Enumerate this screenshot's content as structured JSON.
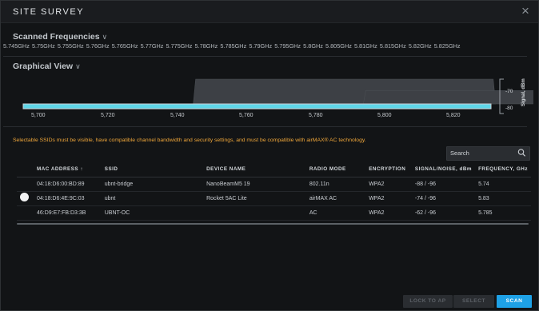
{
  "dialog": {
    "title": "SITE SURVEY",
    "close_glyph": "×"
  },
  "scanned": {
    "title": "Scanned Frequencies",
    "frequencies": [
      "5.745GHz",
      "5.75GHz",
      "5.755GHz",
      "5.76GHz",
      "5.765GHz",
      "5.77GHz",
      "5.775GHz",
      "5.78GHz",
      "5.785GHz",
      "5.79GHz",
      "5.795GHz",
      "5.8GHz",
      "5.805GHz",
      "5.81GHz",
      "5.815GHz",
      "5.82GHz",
      "5.825GHz"
    ]
  },
  "graph": {
    "title": "Graphical View",
    "axis_label": "Signal, dBm",
    "y_ticks": [
      "-70",
      "-80"
    ],
    "x_ticks": [
      "5,700",
      "5,720",
      "5,740",
      "5,760",
      "5,780",
      "5,800",
      "5,820"
    ],
    "x_range": [
      5700,
      5835
    ],
    "y_range": [
      -88,
      -62
    ],
    "colors": {
      "baseline": "#5fd6e8",
      "signal": "#3d4045"
    },
    "signals": [
      {
        "ssid": "ubnt-bridge",
        "center": 5740,
        "width": 20,
        "level": -88
      },
      {
        "ssid": "ubnt",
        "center": 5830,
        "width": 80,
        "level": -74
      },
      {
        "ssid": "UBNT-OC",
        "center": 5785,
        "width": 80,
        "level": -62
      }
    ]
  },
  "warning": "Selectable SSIDs must be visible, have compatible channel bandwidth and security settings, and must be compatible with airMAX® AC technology.",
  "search": {
    "placeholder": "Search"
  },
  "table": {
    "headers": {
      "mac": "MAC ADDRESS",
      "sort_arrow": "↑",
      "ssid": "SSID",
      "device": "DEVICE NAME",
      "mode": "RADIO MODE",
      "enc": "ENCRYPTION",
      "signal": "SIGNAL/NOISE, dBm",
      "freq": "FREQUENCY, GHz"
    },
    "rows": [
      {
        "mac": "04:18:D6:00:BD:89",
        "ssid": "ubnt-bridge",
        "device": "NanoBeamM5 19",
        "mode": "802.11n",
        "enc": "WPA2",
        "signal": "-88 / -96",
        "freq": "5.74"
      },
      {
        "mac": "04:18:D6:4E:9C:03",
        "ssid": "ubnt",
        "device": "Rocket 5AC Lite",
        "mode": "airMAX AC",
        "enc": "WPA2",
        "signal": "-74 / -96",
        "freq": "5.83"
      },
      {
        "mac": "46:D9:E7:FB:D3:3B",
        "ssid": "UBNT-OC",
        "device": "",
        "mode": "AC",
        "enc": "WPA2",
        "signal": "-62 / -96",
        "freq": "5.785"
      }
    ]
  },
  "footer": {
    "lock_label": "LOCK TO AP",
    "select_label": "SELECT",
    "scan_label": "SCAN"
  }
}
